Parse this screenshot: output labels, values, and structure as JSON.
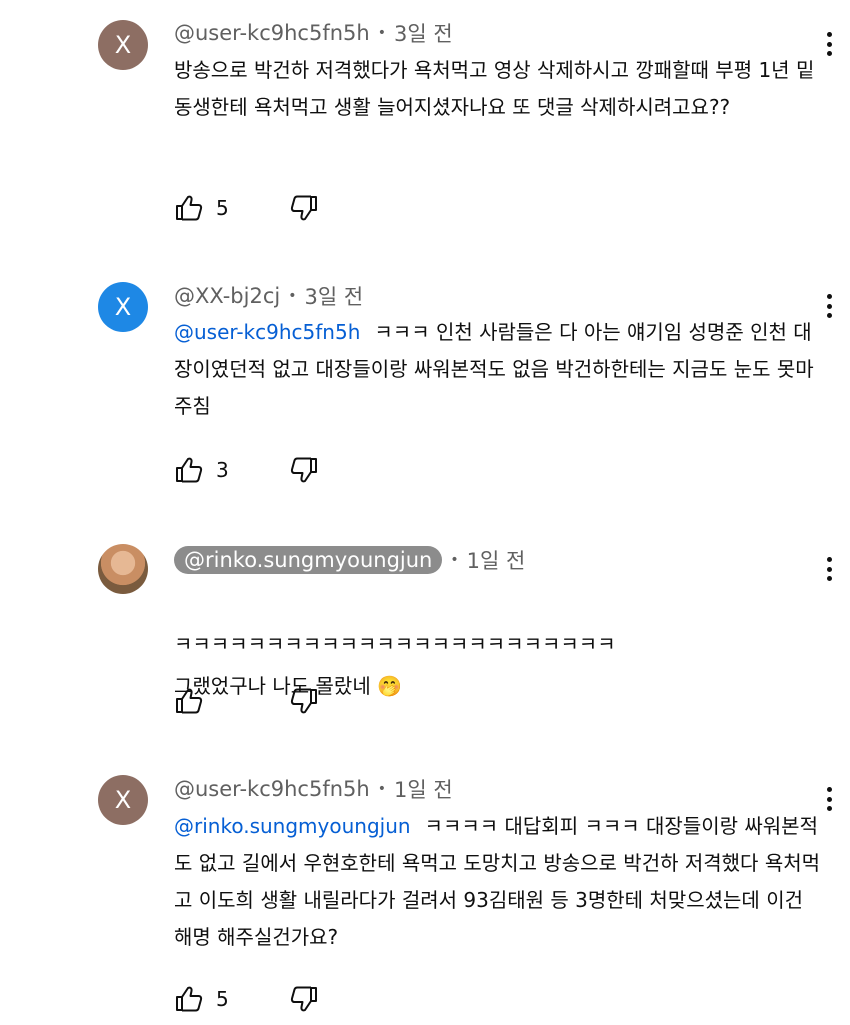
{
  "comments": [
    {
      "avatar_letter": "X",
      "avatar_color": "#8d6e63",
      "handle": "@user-kc9hc5fn5h",
      "time": "3일 전",
      "mention": "",
      "text": "방송으로 박건하 저격했다가 욕처먹고 영상 삭제하시고 깡패할때 부평 1년 밑 동생한테 욕처먹고 생활 늘어지셨자나요 또 댓글 삭제하시려고요??",
      "likes": "5",
      "like_icon": "thumbs-up-icon",
      "dislike_icon": "thumbs-down-icon"
    },
    {
      "avatar_letter": "X",
      "avatar_color": "#1e88e5",
      "handle": "@XX-bj2cj",
      "time": "3일 전",
      "mention": "@user-kc9hc5fn5h",
      "text": "ㅋㅋㅋ 인천 사람들은 다 아는 얘기임 성명준 인천 대장이였던적 없고 대장들이랑 싸워본적도 없음 박건하한테는 지금도 눈도 못마주침",
      "likes": "3",
      "like_icon": "thumbs-up-icon",
      "dislike_icon": "thumbs-down-icon"
    },
    {
      "avatar_letter": "",
      "avatar_color": "#c98e63",
      "handle": "@rinko.sungmyoungjun",
      "time": "1일 전",
      "mention": "",
      "text": "ㅋㅋㅋㅋㅋㅋㅋㅋㅋㅋㅋㅋㅋㅋㅋㅋㅋㅋㅋㅋㅋㅋㅋㅋ\n그랬었구나 나도 몰랐네 🤭",
      "likes": "",
      "like_icon": "thumbs-up-icon",
      "dislike_icon": "thumbs-down-icon"
    },
    {
      "avatar_letter": "X",
      "avatar_color": "#8d6e63",
      "handle": "@user-kc9hc5fn5h",
      "time": "1일 전",
      "mention": "@rinko.sungmyoungjun",
      "text": "ㅋㅋㅋㅋ 대답회피 ㅋㅋㅋ 대장들이랑 싸워본적도 없고 길에서 우현호한테 욕먹고 도망치고 방송으로 박건하 저격했다 욕처먹고 이도희 생활 내릴라다가 걸려서 93김태원 등 3명한테 처맞으셨는데 이건 해명 해주실건가요?",
      "likes": "5",
      "like_icon": "thumbs-up-icon",
      "dislike_icon": "thumbs-down-icon"
    }
  ],
  "colors": {
    "handle": "#606060",
    "mention": "#065fd4",
    "text": "#0f0f0f",
    "handle_pill": "#8c8c8c"
  }
}
